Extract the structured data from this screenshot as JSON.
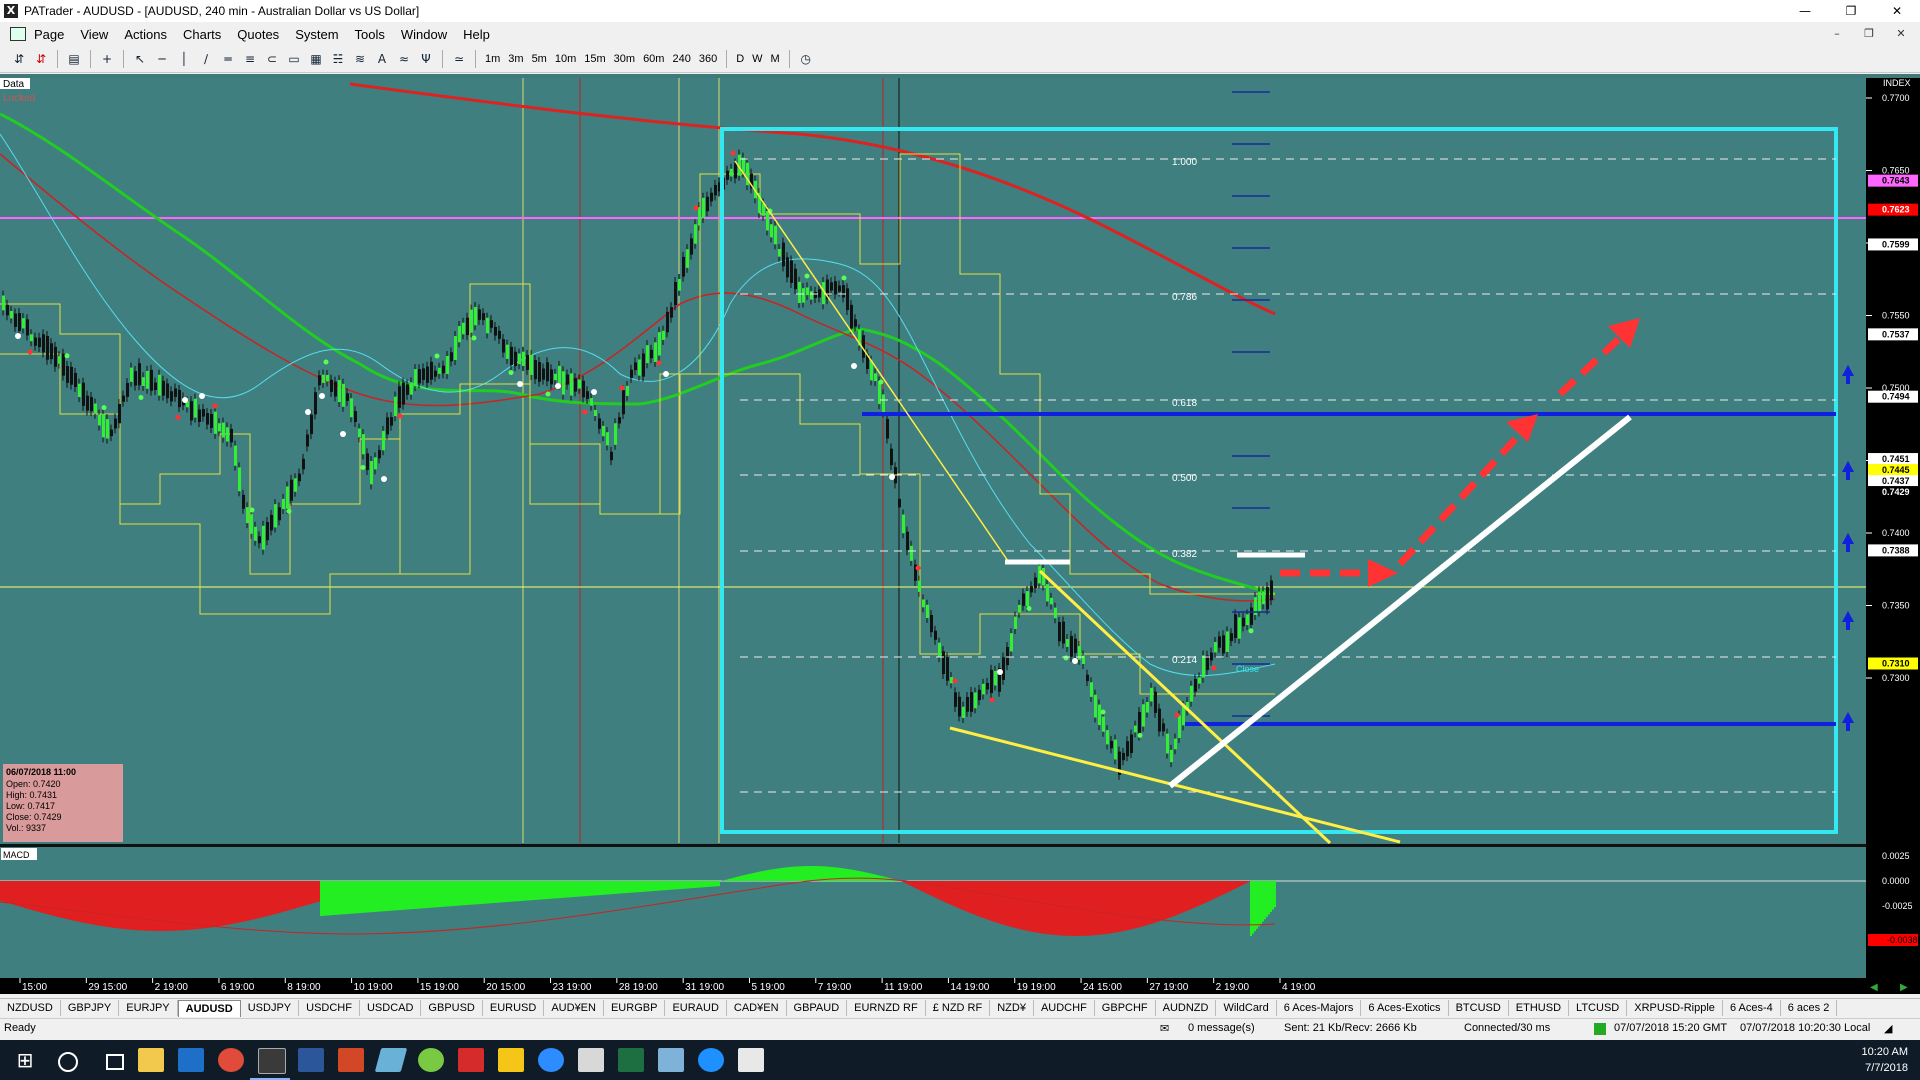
{
  "window": {
    "title": "PATrader - AUDUSD - [AUDUSD, 240 min - Australian Dollar vs US Dollar]",
    "app_letter": "X",
    "minimize": "—",
    "maximize": "❐",
    "close": "✕"
  },
  "menu": [
    "Page",
    "View",
    "Actions",
    "Charts",
    "Quotes",
    "System",
    "Tools",
    "Window",
    "Help"
  ],
  "timeframes": [
    "1m",
    "3m",
    "5m",
    "10m",
    "15m",
    "30m",
    "60m",
    "240",
    "360",
    "D",
    "W",
    "M"
  ],
  "chart": {
    "data_label": "Data",
    "locked_label": "Locked",
    "index_label": "INDEX",
    "macd_label": "MACD",
    "price_ticks": [
      "0.7700",
      "0.7650",
      "0.7600",
      "0.7550",
      "0.7500",
      "0.7450",
      "0.7400",
      "0.7350",
      "0.7300"
    ],
    "price_tags": [
      {
        "text": "0.7643",
        "bg": "#ff66ff"
      },
      {
        "text": "0.7623",
        "bg": "#ff0000"
      },
      {
        "text": "0.7599",
        "bg": "#ffffff"
      },
      {
        "text": "0.7537",
        "bg": "#ffffff"
      },
      {
        "text": "0.7494",
        "bg": "#ffffff"
      },
      {
        "text": "0.7451",
        "bg": "#ffffff"
      },
      {
        "text": "0.7445",
        "bg": "#ffff00"
      },
      {
        "text": "0.7437",
        "bg": "#ffffff"
      },
      {
        "text": "0.7429",
        "bg": "#000000"
      },
      {
        "text": "0.7388",
        "bg": "#ffffff"
      },
      {
        "text": "0.7310",
        "bg": "#ffff00"
      }
    ],
    "macd_ticks": [
      "0.0025",
      "0.0000",
      "-0.0025"
    ],
    "macd_tag": "-0.0038",
    "fib_labels": [
      "1.000",
      "0.786",
      "0.618",
      "0.500",
      "0.382",
      "0.214"
    ],
    "time_labels": [
      "15:00",
      "29 15:00",
      "2 19:00",
      "6 19:00",
      "8 19:00",
      "10 19:00",
      "15 19:00",
      "20 15:00",
      "23 19:00",
      "28 19:00",
      "31 19:00",
      "5 19:00",
      "7 19:00",
      "11 19:00",
      "14 19:00",
      "19 19:00",
      "24 15:00",
      "27 19:00",
      "2 19:00",
      "4 19:00"
    ],
    "ohlc": {
      "date": "06/07/2018 11:00",
      "open": "Open: 0.7420",
      "high": "High: 0.7431",
      "low": "Low: 0.7417",
      "close": "Close: 0.7429",
      "vol": "Vol.: 9337"
    },
    "close_label": "Close"
  },
  "symbol_tabs": [
    "NZDUSD",
    "GBPJPY",
    "EURJPY",
    "AUDUSD",
    "USDJPY",
    "USDCHF",
    "USDCAD",
    "GBPUSD",
    "EURUSD",
    "AUD¥EN",
    "EURGBP",
    "EURAUD",
    "CAD¥EN",
    "GBPAUD",
    "EURNZD RF",
    "£ NZD RF",
    "NZD¥",
    "AUDCHF",
    "GBPCHF",
    "AUDNZD",
    "WildCard",
    "6 Aces-Majors",
    "6 Aces-Exotics",
    "BTCUSD",
    "ETHUSD",
    "LTCUSD",
    "XRPUSD-Ripple",
    "6 Aces-4",
    "6 aces 2"
  ],
  "active_tab": "AUDUSD",
  "status": {
    "ready": "Ready",
    "messages": "0 message(s)",
    "traffic": "Sent: 21 Kb/Recv: 2666 Kb",
    "connection": "Connected/30 ms",
    "gmt": "07/07/2018 15:20 GMT",
    "local": "07/07/2018 10:20:30 Local"
  },
  "taskbar": {
    "time": "10:20 AM",
    "date": "7/7/2018"
  }
}
